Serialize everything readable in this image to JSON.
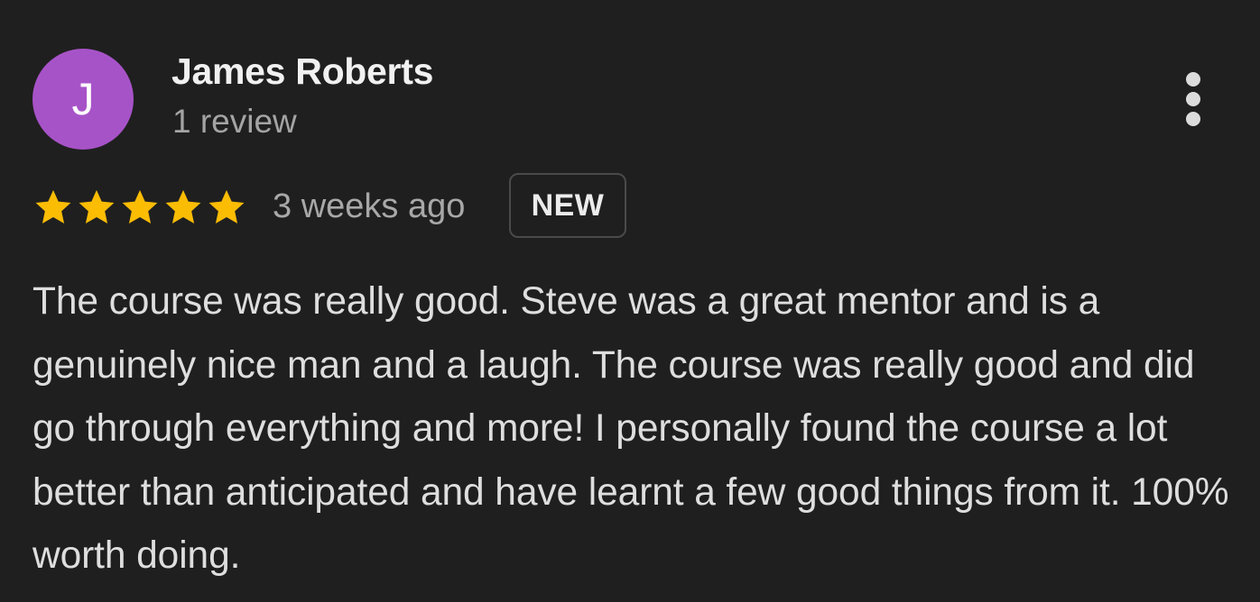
{
  "review": {
    "avatar_letter": "J",
    "avatar_color": "#a753c8",
    "reviewer_name": "James Roberts",
    "review_count": "1 review",
    "rating": 5,
    "rating_max": 5,
    "star_color": "#fbbc04",
    "date": "3 weeks ago",
    "badge": "NEW",
    "text": "The course was really good. Steve was a great mentor and is a genuinely nice man and a laugh. The course was really good and did go through everything and more! I personally found the course a lot better than anticipated and have learnt a few good things from it. 100% worth doing.",
    "menu_icon": "more-vert-icon"
  }
}
